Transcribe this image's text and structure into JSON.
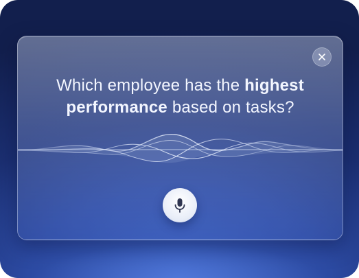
{
  "dialog": {
    "question_parts": [
      {
        "text": "Which employee has the ",
        "bold": false
      },
      {
        "text": "highest",
        "bold": true
      },
      {
        "text": " performance",
        "bold": true
      },
      {
        "text": " based on tasks?",
        "bold": false
      }
    ]
  },
  "icons": {
    "close": "close-icon",
    "mic": "microphone-icon"
  },
  "colors": {
    "background_top": "#121f4d",
    "background_bottom": "#3f66c9",
    "text": "#f3f6ff",
    "mic_icon": "#2f3550"
  }
}
